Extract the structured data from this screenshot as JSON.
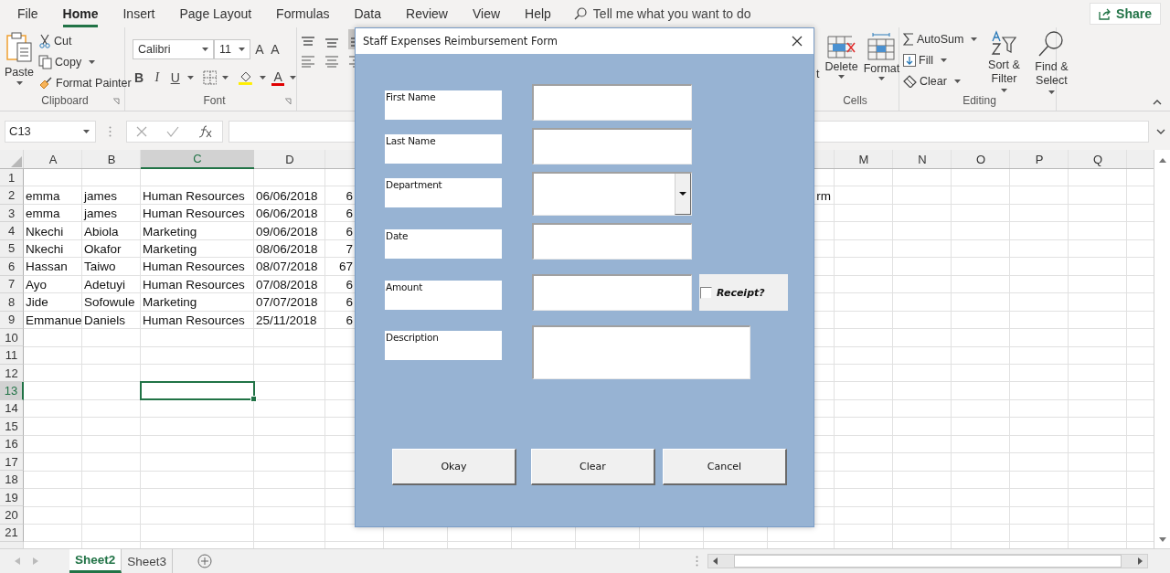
{
  "menu_tabs": [
    {
      "label": "File",
      "selected": false
    },
    {
      "label": "Home",
      "selected": true
    },
    {
      "label": "Insert",
      "selected": false
    },
    {
      "label": "Page Layout",
      "selected": false
    },
    {
      "label": "Formulas",
      "selected": false
    },
    {
      "label": "Data",
      "selected": false
    },
    {
      "label": "Review",
      "selected": false
    },
    {
      "label": "View",
      "selected": false
    },
    {
      "label": "Help",
      "selected": false
    }
  ],
  "tell_me": {
    "placeholder": "Tell me what you want to do"
  },
  "share": "Share",
  "ribbon": {
    "clipboard": {
      "paste": "Paste",
      "cut": "Cut",
      "copy": "Copy",
      "format_painter": "Format Painter",
      "label": "Clipboard"
    },
    "font": {
      "name": "Calibri",
      "size": "11",
      "grow": "A",
      "shrink": "A",
      "bold": "B",
      "italic": "I",
      "underline": "U",
      "color_button": "A",
      "label": "Font"
    },
    "cells": {
      "insert": "t",
      "delete": "Delete",
      "format": "Format",
      "label": "Cells"
    },
    "editing": {
      "autosum": "AutoSum",
      "fill": "Fill",
      "clear": "Clear",
      "sort": "Sort & Filter",
      "find": "Find & Select",
      "label": "Editing"
    }
  },
  "name_box": "C13",
  "sheet": {
    "columns_left": [
      {
        "label": "A",
        "selected": false
      },
      {
        "label": "B",
        "selected": false
      },
      {
        "label": "C",
        "selected": true
      },
      {
        "label": "D",
        "selected": false
      }
    ],
    "columns_right": [
      {
        "label": "M",
        "selected": false
      },
      {
        "label": "N",
        "selected": false
      },
      {
        "label": "O",
        "selected": false
      },
      {
        "label": "P",
        "selected": false
      },
      {
        "label": "Q",
        "selected": false
      }
    ],
    "rows": [
      {
        "number": "1",
        "selected": false
      },
      {
        "number": "2",
        "selected": false,
        "cells": [
          "emma",
          "james",
          "Human Resources",
          "06/06/2018",
          "6"
        ],
        "partial_cell": "rm"
      },
      {
        "number": "3",
        "selected": false,
        "cells": [
          "emma",
          "james",
          "Human Resources",
          "06/06/2018",
          "6"
        ]
      },
      {
        "number": "4",
        "selected": false,
        "cells": [
          "Nkechi",
          "Abiola",
          "Marketing",
          "09/06/2018",
          "6"
        ]
      },
      {
        "number": "5",
        "selected": false,
        "cells": [
          "Nkechi",
          "Okafor",
          "Marketing",
          "08/06/2018",
          "7"
        ]
      },
      {
        "number": "6",
        "selected": false,
        "cells": [
          "Hassan",
          "Taiwo",
          "Human Resources",
          "08/07/2018",
          "67"
        ]
      },
      {
        "number": "7",
        "selected": false,
        "cells": [
          "Ayo",
          "Adetuyi",
          "Human Resources",
          "07/08/2018",
          "6"
        ]
      },
      {
        "number": "8",
        "selected": false,
        "cells": [
          "Jide",
          "Sofowule",
          "Marketing",
          "07/07/2018",
          "6"
        ]
      },
      {
        "number": "9",
        "selected": false,
        "cells": [
          "Emmanue",
          "Daniels",
          "Human Resources",
          "25/11/2018",
          "6"
        ]
      },
      {
        "number": "10",
        "selected": false
      },
      {
        "number": "11",
        "selected": false
      },
      {
        "number": "12",
        "selected": false
      },
      {
        "number": "13",
        "selected": true
      },
      {
        "number": "14",
        "selected": false
      },
      {
        "number": "15",
        "selected": false
      },
      {
        "number": "16",
        "selected": false
      },
      {
        "number": "17",
        "selected": false
      },
      {
        "number": "18",
        "selected": false
      },
      {
        "number": "19",
        "selected": false
      },
      {
        "number": "20",
        "selected": false
      },
      {
        "number": "21",
        "selected": false
      }
    ]
  },
  "sheet_tabs": [
    {
      "label": "Sheet2",
      "selected": true
    },
    {
      "label": "Sheet3",
      "selected": false
    }
  ],
  "dialog": {
    "title": "Staff Expenses Reimbursement Form",
    "fields": [
      {
        "label": "First Name",
        "kind": "text"
      },
      {
        "label": "Last Name",
        "kind": "text"
      },
      {
        "label": "Department",
        "kind": "combo"
      },
      {
        "label": "Date",
        "kind": "text"
      },
      {
        "label": "Amount",
        "kind": "text",
        "checkbox": {
          "label": "Receipt?",
          "checked": false
        }
      },
      {
        "label": "Description",
        "kind": "memo"
      }
    ],
    "buttons": [
      "Okay",
      "Clear",
      "Cancel"
    ]
  }
}
